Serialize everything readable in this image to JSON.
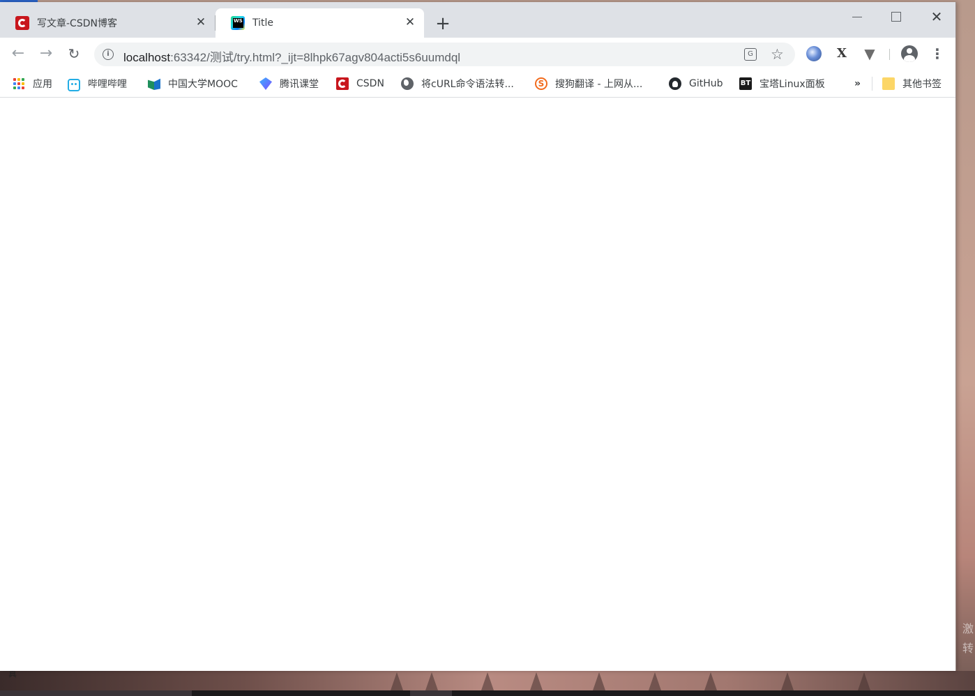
{
  "tabs": [
    {
      "title": "写文章-CSDN博客",
      "icon": "csdn-logo-icon"
    },
    {
      "title": "Title",
      "icon": "webstorm-icon",
      "active": true
    }
  ],
  "address_bar": {
    "url_host": "localhost",
    "url_rest": ":63342/测试/try.html?_ijt=8lhpk67agv804acti5s6uumdql"
  },
  "bookmarks": [
    {
      "label": "应用",
      "icon": "apps-grid-icon"
    },
    {
      "label": "哔哩哔哩",
      "icon": "bilibili-icon"
    },
    {
      "label": "中国大学MOOC",
      "icon": "mooc-icon"
    },
    {
      "label": "腾讯课堂",
      "icon": "tencent-classroom-icon"
    },
    {
      "label": "CSDN",
      "icon": "csdn-logo-icon"
    },
    {
      "label": "将cURL命令语法转...",
      "icon": "globe-icon"
    },
    {
      "label": "搜狗翻译 - 上网从...",
      "icon": "sogou-icon"
    },
    {
      "label": "GitHub",
      "icon": "github-icon"
    },
    {
      "label": "宝塔Linux面板",
      "icon": "bt-icon"
    }
  ],
  "bookmarks_more": "»",
  "other_bookmarks": {
    "label": "其他书签",
    "icon": "folder-icon"
  },
  "desktop": {
    "corner_label": "真",
    "side_text": [
      "激",
      "转"
    ]
  },
  "colors": {
    "tabstrip": "#dee1e6",
    "omnibox": "#f1f3f4",
    "csdn_red": "#c8161d"
  }
}
